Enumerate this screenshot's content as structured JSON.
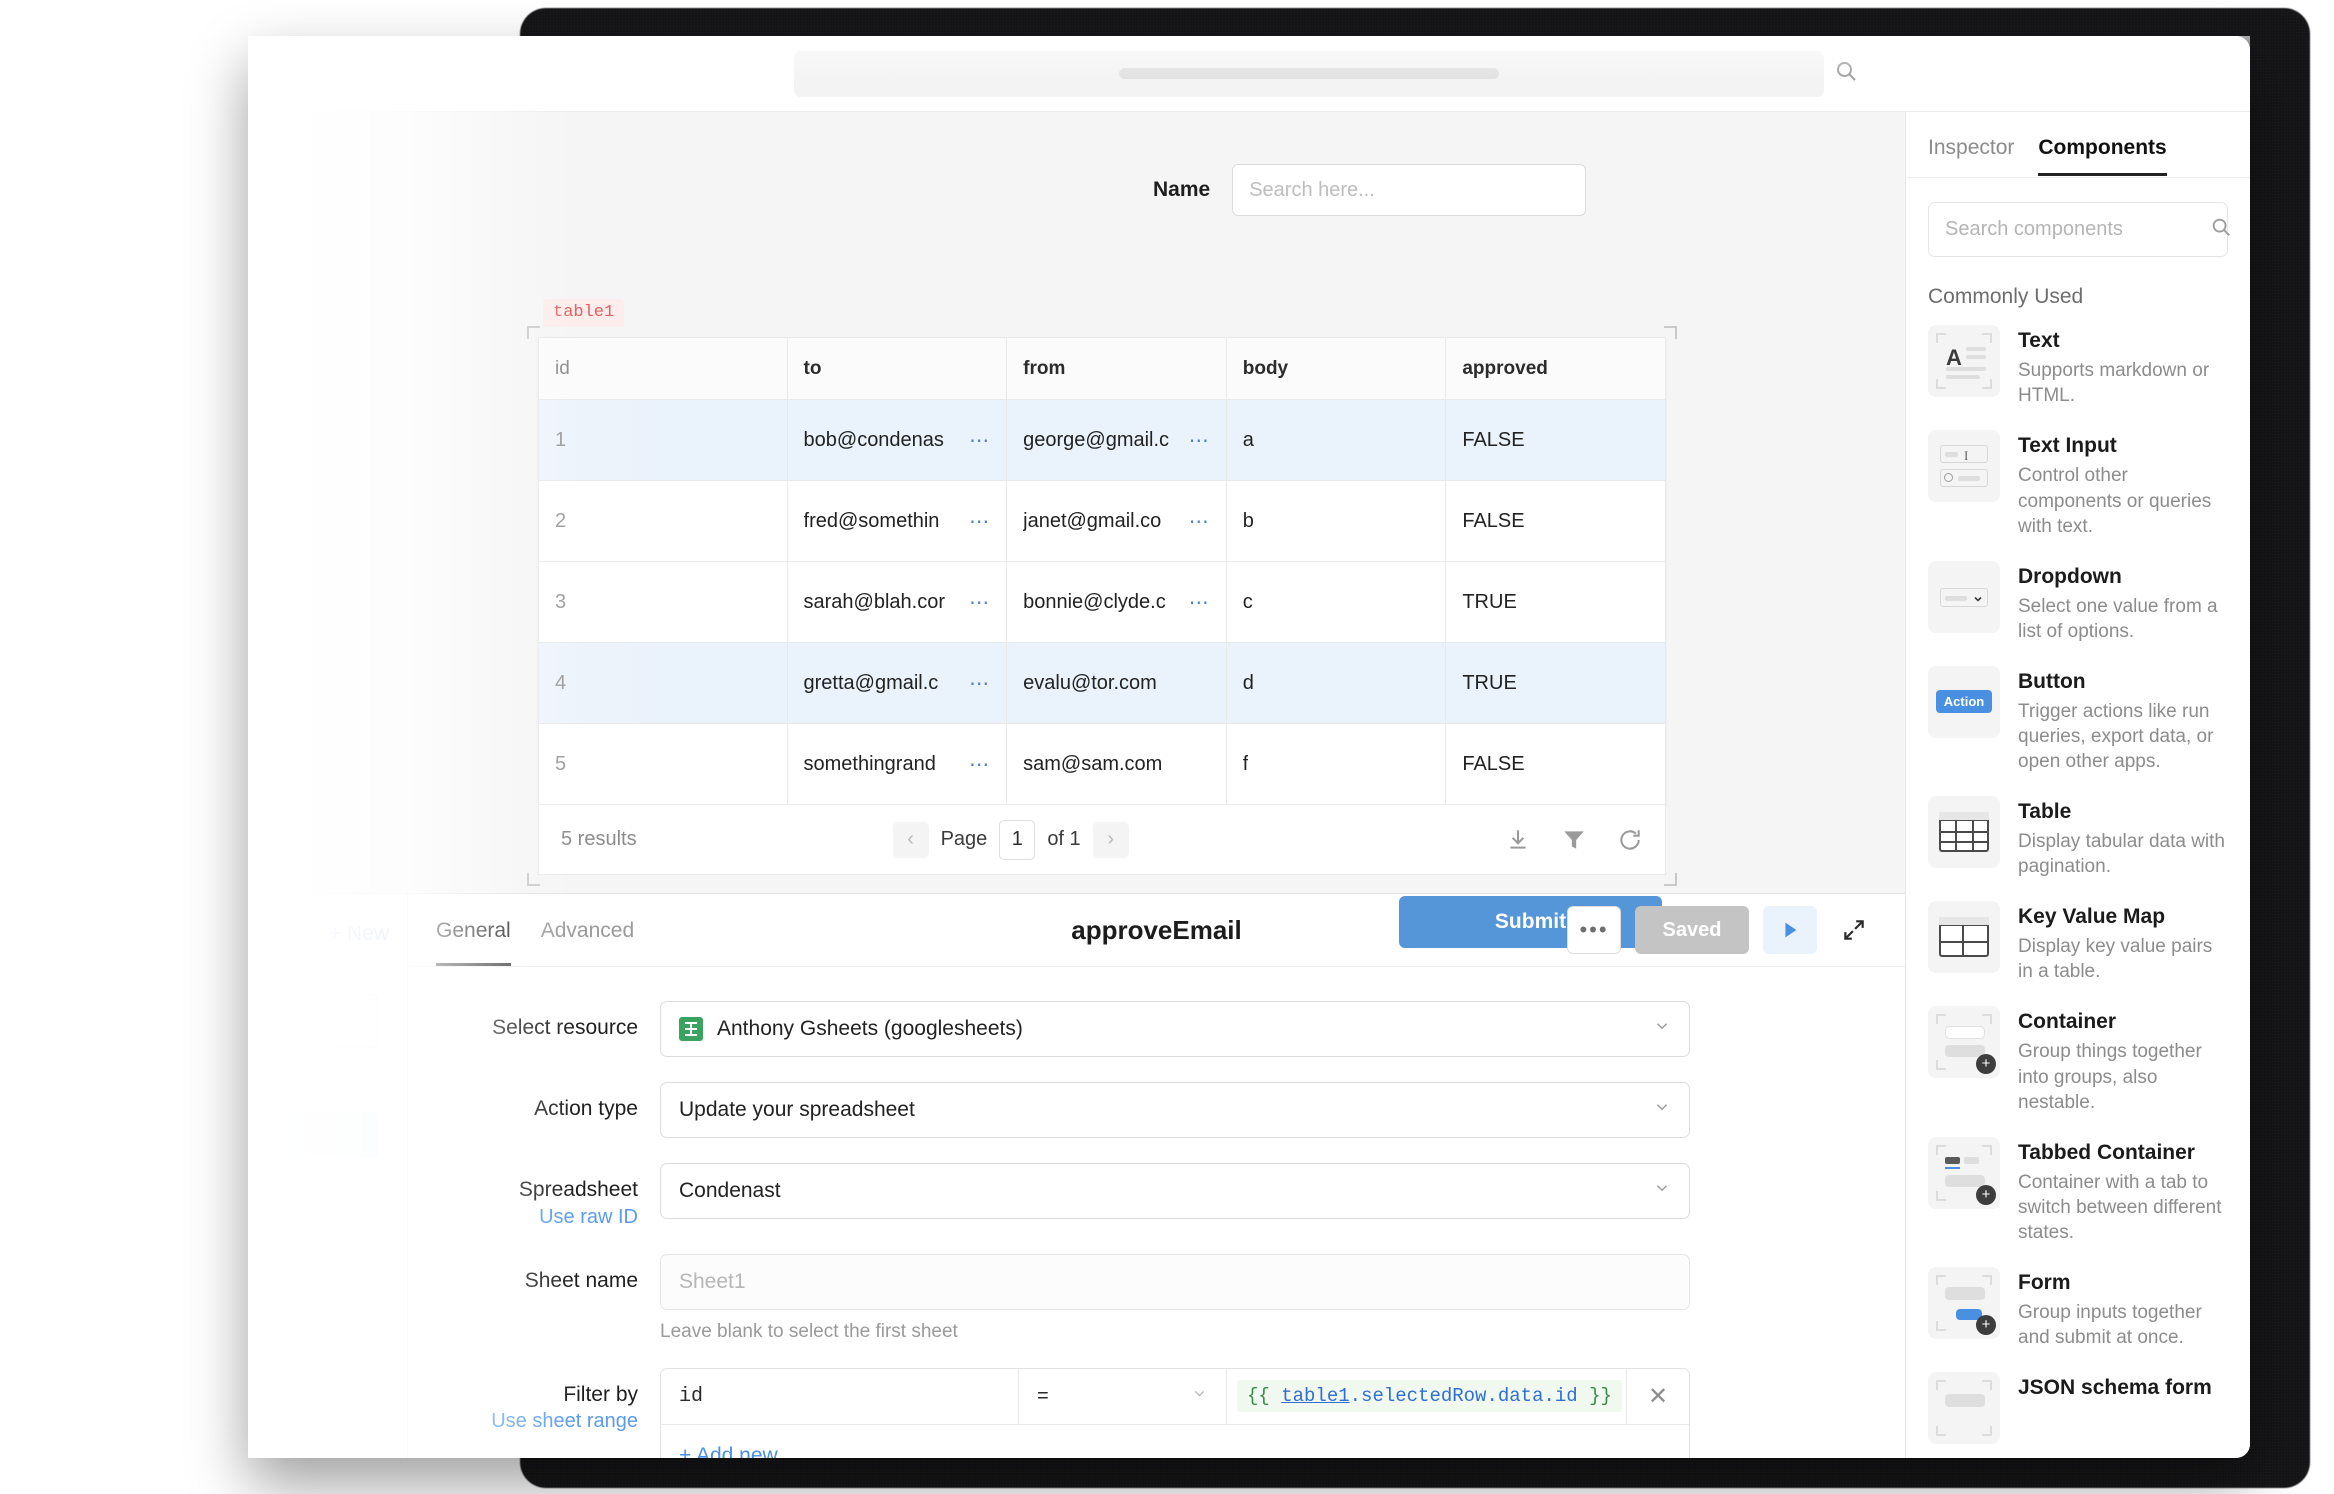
{
  "browser": {
    "search_icon": "search-icon"
  },
  "canvas": {
    "name_label": "Name",
    "name_placeholder": "Search here...",
    "name_value": "",
    "table_badge": "table1",
    "submit_label": "Submit",
    "table": {
      "columns": [
        "id",
        "to",
        "from",
        "body",
        "approved"
      ],
      "rows": [
        {
          "id": "1",
          "to": "bob@condenas",
          "from": "george@gmail.c",
          "body": "a",
          "approved": "FALSE",
          "selected": true,
          "to_trunc": true,
          "from_trunc": true
        },
        {
          "id": "2",
          "to": "fred@somethin",
          "from": "janet@gmail.co",
          "body": "b",
          "approved": "FALSE",
          "selected": false,
          "to_trunc": true,
          "from_trunc": true
        },
        {
          "id": "3",
          "to": "sarah@blah.cor",
          "from": "bonnie@clyde.c",
          "body": "c",
          "approved": "TRUE",
          "selected": false,
          "to_trunc": true,
          "from_trunc": true
        },
        {
          "id": "4",
          "to": "gretta@gmail.c",
          "from": "evalu@tor.com",
          "body": "d",
          "approved": "TRUE",
          "selected": true,
          "to_trunc": true,
          "from_trunc": false
        },
        {
          "id": "5",
          "to": "somethingrand",
          "from": "sam@sam.com",
          "body": "f",
          "approved": "FALSE",
          "selected": false,
          "to_trunc": true,
          "from_trunc": false
        }
      ],
      "results_text": "5 results",
      "page_label": "Page",
      "page_value": "1",
      "of_label": "of 1",
      "prev_icon": "chevron-left-icon",
      "next_icon": "chevron-right-icon",
      "download_icon": "download-icon",
      "filter_icon": "filter-icon",
      "refresh_icon": "refresh-icon"
    }
  },
  "editor": {
    "new_label": "+ New",
    "tabs": [
      {
        "label": "General",
        "active": true
      },
      {
        "label": "Advanced",
        "active": false
      }
    ],
    "query_name": "approveEmail",
    "more_label": "•••",
    "saved_label": "Saved",
    "run_icon": "play-icon",
    "expand_icon": "expand-icon",
    "fields": {
      "resource_label": "Select resource",
      "resource_value": "Anthony Gsheets (googlesheets)",
      "resource_icon": "google-sheets-icon",
      "action_label": "Action type",
      "action_value": "Update your spreadsheet",
      "spreadsheet_label": "Spreadsheet",
      "spreadsheet_sublink": "Use raw ID",
      "spreadsheet_value": "Condenast",
      "sheet_label": "Sheet name",
      "sheet_placeholder": "Sheet1",
      "sheet_helper": "Leave blank to select the first sheet",
      "filter_label": "Filter by",
      "filter_sublink": "Use sheet range",
      "filter_key": "id",
      "filter_op": "=",
      "filter_value_tokens": {
        "open": "{{ ",
        "var": "table1",
        "path": ".selectedRow.data.id",
        "close": " }}"
      },
      "filter_remove_icon": "close-icon",
      "add_new_label": "+ Add new"
    }
  },
  "right_panel": {
    "tabs": [
      {
        "label": "Inspector",
        "active": false
      },
      {
        "label": "Components",
        "active": true
      }
    ],
    "search_placeholder": "Search components",
    "search_value": "",
    "search_icon": "search-icon",
    "section_title": "Commonly Used",
    "components": [
      {
        "name": "Text",
        "desc": "Supports markdown or HTML.",
        "icon": "text-component-icon"
      },
      {
        "name": "Text Input",
        "desc": "Control other components or queries with text.",
        "icon": "text-input-component-icon"
      },
      {
        "name": "Dropdown",
        "desc": "Select one value from a list of options.",
        "icon": "dropdown-component-icon"
      },
      {
        "name": "Button",
        "desc": "Trigger actions like run queries, export data, or open other apps.",
        "icon": "button-component-icon",
        "chip": "Action"
      },
      {
        "name": "Table",
        "desc": "Display tabular data with pagination.",
        "icon": "table-component-icon"
      },
      {
        "name": "Key Value Map",
        "desc": "Display key value pairs in a table.",
        "icon": "key-value-map-component-icon"
      },
      {
        "name": "Container",
        "desc": "Group things together into groups, also nestable.",
        "icon": "container-component-icon"
      },
      {
        "name": "Tabbed Container",
        "desc": "Container with a tab to switch between different states.",
        "icon": "tabbed-container-component-icon"
      },
      {
        "name": "Form",
        "desc": "Group inputs together and submit at once.",
        "icon": "form-component-icon"
      },
      {
        "name": "JSON schema form",
        "desc": "",
        "icon": "json-schema-form-component-icon"
      }
    ]
  },
  "colors": {
    "accent_blue": "#4a90e2",
    "submit_blue": "#5596d8",
    "badge_red": "#e06161",
    "sheets_green": "#3aa35f",
    "row_selected": "#eaf2fb"
  }
}
